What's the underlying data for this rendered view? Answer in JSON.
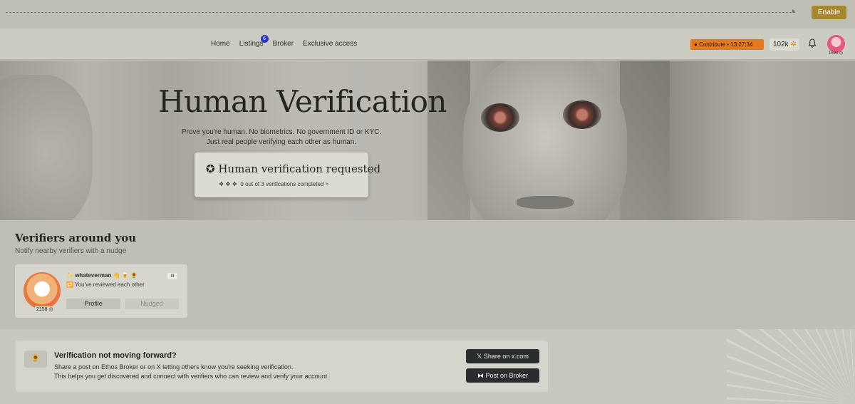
{
  "banner": {
    "arrow": "▸",
    "enable_label": "Enable"
  },
  "nav": {
    "links": [
      {
        "label": "Home"
      },
      {
        "label": "Listings",
        "badge": "6"
      },
      {
        "label": "Broker"
      },
      {
        "label": "Exclusive access"
      }
    ],
    "contribute": {
      "label": "Contribute",
      "separator": "•",
      "timer": "13:27:34"
    },
    "credits": {
      "value": "102k",
      "icon": "✲"
    },
    "bell_icon": "🔔",
    "avatar_count": "1590 ◎"
  },
  "hero": {
    "title": "Human Verification",
    "subtitle_line1": "Prove you're human. No biometrics. No government ID or KYC.",
    "subtitle_line2": "Just real people verifying each other as human.",
    "card_title": "Human verification requested",
    "card_progress": "0 out of 3 verifications completed",
    "card_icon": "✪",
    "card_progress_icons": "❖ ❖ ❖",
    "card_chevron": ">"
  },
  "verifiers": {
    "title": "Verifiers around you",
    "subtitle": "Notify nearby verifiers with a nudge",
    "card": {
      "name": "whateverman",
      "name_emojis": "👋 🍺 🌻",
      "name_prefix_emoji": "✨",
      "status": "You've reviewed each other",
      "status_icon": "🔁",
      "score": "2158 ◎",
      "menu": "III",
      "profile_label": "Profile",
      "nudged_label": "Nudged"
    }
  },
  "notice": {
    "icon": "🌻",
    "title": "Verification not moving forward?",
    "line1": "Share a post on Ethos Broker or on X letting others know you're seeking verification.",
    "line2": "This helps you get discovered and connect with verifiers who can review and verify your account.",
    "share_x_label": "Share on x.com",
    "share_x_icon": "𝕏",
    "post_broker_label": "Post on Broker",
    "post_broker_icon": "⧓"
  }
}
